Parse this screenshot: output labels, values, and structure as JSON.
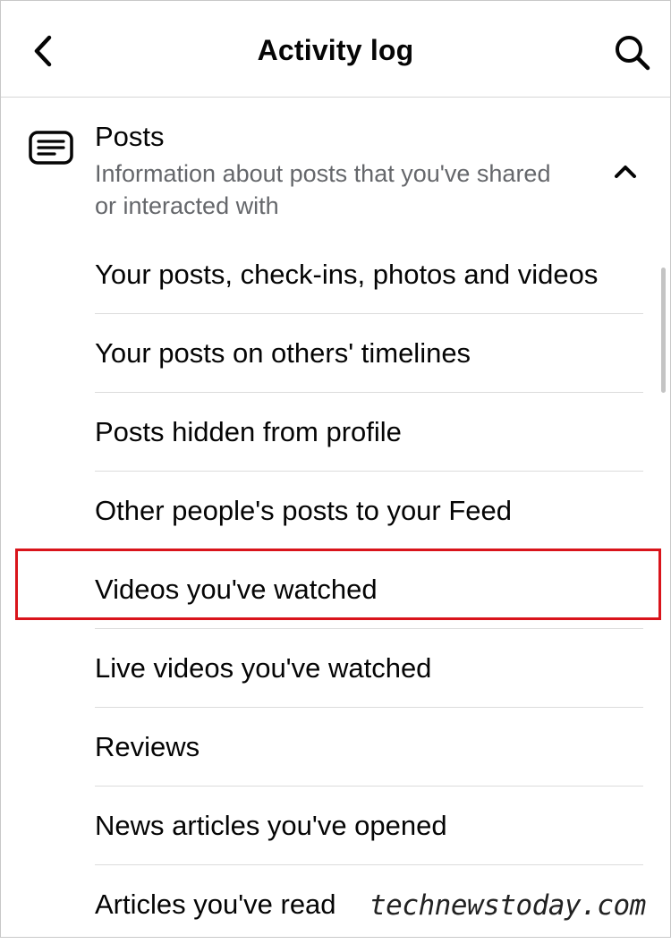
{
  "header": {
    "title": "Activity log",
    "back_icon": "chevron-left-icon",
    "search_icon": "search-icon"
  },
  "section": {
    "title": "Posts",
    "description": "Information about posts that you've shared or interacted with",
    "icon": "posts-icon",
    "toggle_icon": "chevron-up-icon"
  },
  "items": [
    {
      "label": "Your posts, check-ins, photos and videos"
    },
    {
      "label": "Your posts on others' timelines"
    },
    {
      "label": "Posts hidden from profile"
    },
    {
      "label": "Other people's posts to your Feed"
    },
    {
      "label": "Videos you've watched",
      "highlighted": true
    },
    {
      "label": "Live videos you've watched"
    },
    {
      "label": "Reviews"
    },
    {
      "label": "News articles you've opened"
    },
    {
      "label": "Articles you've read"
    }
  ],
  "colors": {
    "highlight": "#d9141b",
    "secondary_text": "#65676b",
    "divider": "#dcdcdc"
  },
  "watermark": "technewstoday.com"
}
